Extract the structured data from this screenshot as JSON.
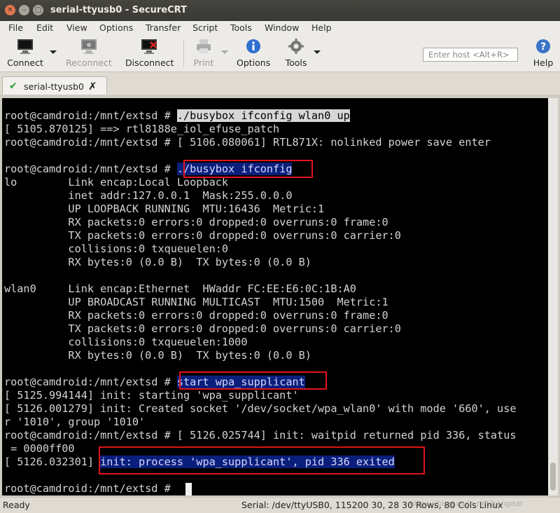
{
  "window": {
    "title": "serial-ttyusb0 - SecureCRT"
  },
  "menu": [
    "File",
    "Edit",
    "View",
    "Options",
    "Transfer",
    "Script",
    "Tools",
    "Window",
    "Help"
  ],
  "toolbar": {
    "connect": "Connect",
    "reconnect": "Reconnect",
    "disconnect": "Disconnect",
    "print": "Print",
    "options": "Options",
    "tools": "Tools",
    "help": "Help",
    "host_placeholder": "Enter host <Alt+R>"
  },
  "tab": {
    "label": "serial-ttyusb0"
  },
  "terminal": {
    "lines": [
      "",
      "root@camdroid:/mnt/extsd # ./busybox ifconfig wlan0 up",
      "[ 5105.870125] ==> rtl8188e_iol_efuse_patch",
      "root@camdroid:/mnt/extsd # [ 5106.080061] RTL871X: nolinked power save enter",
      "",
      "root@camdroid:/mnt/extsd # ./busybox ifconfig",
      "lo        Link encap:Local Loopback",
      "          inet addr:127.0.0.1  Mask:255.0.0.0",
      "          UP LOOPBACK RUNNING  MTU:16436  Metric:1",
      "          RX packets:0 errors:0 dropped:0 overruns:0 frame:0",
      "          TX packets:0 errors:0 dropped:0 overruns:0 carrier:0",
      "          collisions:0 txqueuelen:0",
      "          RX bytes:0 (0.0 B)  TX bytes:0 (0.0 B)",
      "",
      "wlan0     Link encap:Ethernet  HWaddr FC:EE:E6:0C:1B:A0",
      "          UP BROADCAST RUNNING MULTICAST  MTU:1500  Metric:1",
      "          RX packets:0 errors:0 dropped:0 overruns:0 frame:0",
      "          TX packets:0 errors:0 dropped:0 overruns:0 carrier:0",
      "          collisions:0 txqueuelen:1000",
      "          RX bytes:0 (0.0 B)  TX bytes:0 (0.0 B)",
      "",
      "root@camdroid:/mnt/extsd # start wpa_supplicant",
      "[ 5125.994144] init: starting 'wpa_supplicant'",
      "[ 5126.001279] init: Created socket '/dev/socket/wpa_wlan0' with mode '660', use",
      "r '1010', group '1010'",
      "root@camdroid:/mnt/extsd # [ 5126.025744] init: waitpid returned pid 336, status",
      " = 0000ff00",
      "[ 5126.032301] init: process 'wpa_supplicant', pid 336 exited",
      "",
      "root@camdroid:/mnt/extsd # "
    ]
  },
  "status": {
    "state": "Ready",
    "info": "Serial: /dev/ttyUSB0, 115200  30, 28  30 Rows, 80 Cols  Linux"
  },
  "watermark": "https://blog.csdn.net/kangear",
  "colors": {
    "highlight_box": "#e0141b",
    "selection_bg": "#0a1f7c",
    "terminal_bg": "#000000"
  }
}
